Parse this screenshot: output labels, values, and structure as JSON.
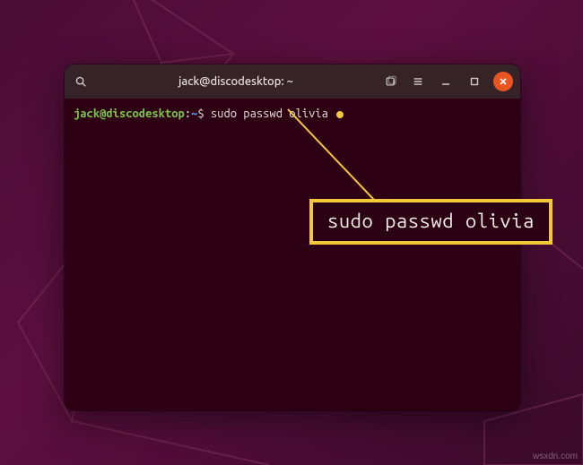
{
  "titlebar": {
    "title": "jack@discodesktop: ~"
  },
  "icons": {
    "search": "search-icon",
    "newtab": "new-tab-icon",
    "menu": "hamburger-icon",
    "min": "minimize-icon",
    "max": "maximize-icon",
    "close": "close-icon"
  },
  "prompt": {
    "userhost": "jack@discodesktop",
    "colon": ":",
    "path": "~",
    "dollar": "$",
    "command": " sudo passwd olivia "
  },
  "callout": {
    "text": "sudo passwd olivia"
  },
  "watermark": "wsxdn.com",
  "colors": {
    "accent_close": "#e95420",
    "callout_border": "#f2c838",
    "prompt_user": "#7cc04a",
    "prompt_path": "#5a8bd6",
    "terminal_bg": "#2d0014"
  }
}
